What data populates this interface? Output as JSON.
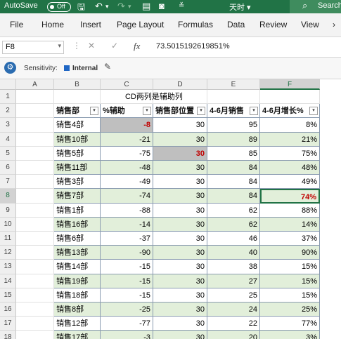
{
  "titlebar": {
    "autosave_label": "AutoSave",
    "autosave_state": "Off",
    "file_name": "天时",
    "search_label": "Search"
  },
  "menu": [
    "File",
    "Home",
    "Insert",
    "Page Layout",
    "Formulas",
    "Data",
    "Review",
    "View"
  ],
  "formula_bar": {
    "cell_ref": "F8",
    "formula": "73.5015192619851%"
  },
  "sensitivity": {
    "label": "Sensitivity:",
    "value": "Internal"
  },
  "columns": [
    "A",
    "B",
    "C",
    "D",
    "E",
    "F"
  ],
  "rows": [
    "1",
    "2",
    "3",
    "4",
    "5",
    "6",
    "7",
    "8",
    "9",
    "10",
    "11",
    "12",
    "13",
    "14",
    "15",
    "16",
    "17",
    "18"
  ],
  "sheet": {
    "note": "CD两列是辅助列",
    "headers": [
      "销售部",
      "%辅助",
      "销售部位置",
      "4-6月销售",
      "4-6月增长%"
    ],
    "data": [
      [
        "销售4部",
        "-8",
        "30",
        "95",
        "8%"
      ],
      [
        "销售10部",
        "-21",
        "30",
        "89",
        "21%"
      ],
      [
        "销售5部",
        "-75",
        "30",
        "85",
        "75%"
      ],
      [
        "销售11部",
        "-48",
        "30",
        "84",
        "48%"
      ],
      [
        "销售3部",
        "-49",
        "30",
        "84",
        "49%"
      ],
      [
        "销售7部",
        "-74",
        "30",
        "84",
        "74%"
      ],
      [
        "销售1部",
        "-88",
        "30",
        "62",
        "88%"
      ],
      [
        "销售16部",
        "-14",
        "30",
        "62",
        "14%"
      ],
      [
        "销售6部",
        "-37",
        "30",
        "46",
        "37%"
      ],
      [
        "销售13部",
        "-90",
        "30",
        "40",
        "90%"
      ],
      [
        "销售14部",
        "-15",
        "30",
        "38",
        "15%"
      ],
      [
        "销售19部",
        "-15",
        "30",
        "27",
        "15%"
      ],
      [
        "销售18部",
        "-15",
        "30",
        "25",
        "15%"
      ],
      [
        "销售8部",
        "-25",
        "30",
        "24",
        "25%"
      ],
      [
        "销售12部",
        "-77",
        "30",
        "22",
        "77%"
      ],
      [
        "销售17部",
        "-3",
        "30",
        "20",
        "3%"
      ]
    ]
  },
  "colors": {
    "excel_green": "#217346",
    "band_green": "#e2efda",
    "highlight_red": "#c00000",
    "highlight_gray": "#bfbfbf"
  }
}
